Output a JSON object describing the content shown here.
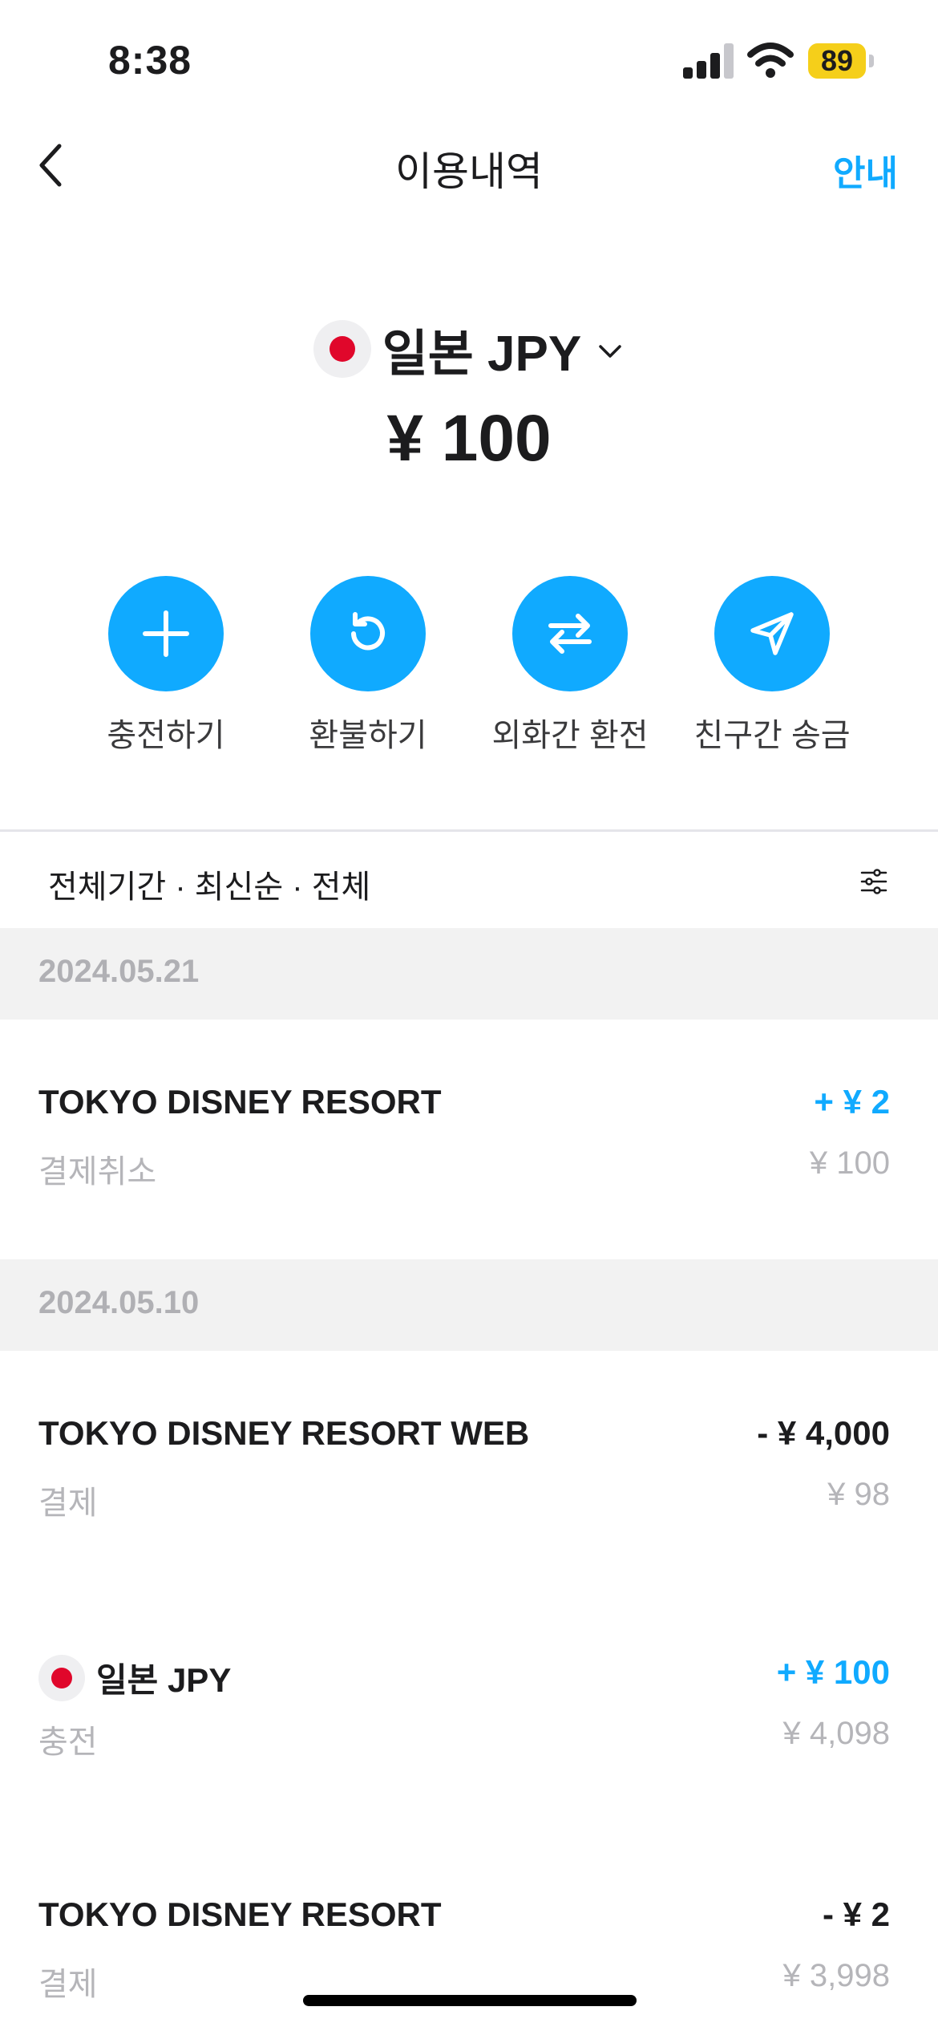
{
  "status_bar": {
    "time": "8:38",
    "battery": "89",
    "battery_color": "#f5cf1a"
  },
  "nav": {
    "title": "이용내역",
    "info_label": "안내"
  },
  "currency": {
    "flag": "japan-flag",
    "name": "일본 JPY",
    "balance": "¥ 100"
  },
  "actions": [
    {
      "label": "충전하기",
      "icon": "plus-icon"
    },
    {
      "label": "환불하기",
      "icon": "refresh-icon"
    },
    {
      "label": "외화간 환전",
      "icon": "exchange-icon"
    },
    {
      "label": "친구간 송금",
      "icon": "send-icon"
    }
  ],
  "filter": {
    "label": "전체기간 · 최신순 · 전체"
  },
  "groups": [
    {
      "date": "2024.05.21",
      "transactions": [
        {
          "merchant": "TOKYO DISNEY RESORT",
          "type": "결제취소",
          "amount": "+ ¥ 2",
          "balance": "¥ 100"
        }
      ]
    },
    {
      "date": "2024.05.10",
      "transactions": [
        {
          "merchant": "TOKYO DISNEY RESORT WEB",
          "type": "결제",
          "amount": "- ¥ 4,000",
          "balance": "¥ 98"
        },
        {
          "merchant": "일본 JPY",
          "type": "충전",
          "amount": "+ ¥ 100",
          "balance": "¥ 4,098"
        },
        {
          "merchant": "TOKYO DISNEY RESORT",
          "type": "결제",
          "amount": "- ¥ 2",
          "balance": "¥ 3,998"
        }
      ]
    }
  ],
  "colors": {
    "accent": "#10aaff",
    "flag_red": "#e0072b"
  }
}
